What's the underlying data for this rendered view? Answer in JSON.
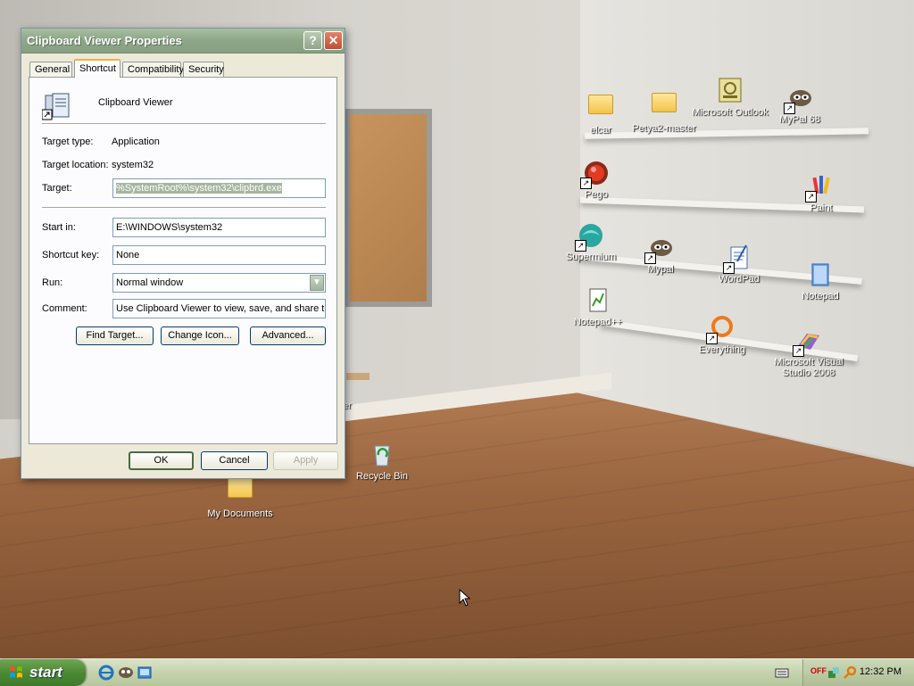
{
  "window": {
    "title": "Clipboard Viewer Properties",
    "help_glyph": "?",
    "close_glyph": "✕",
    "tabs": [
      "General",
      "Shortcut",
      "Compatibility",
      "Security"
    ],
    "active_tab": "Shortcut",
    "app_name": "Clipboard Viewer",
    "fields": {
      "target_type_label": "Target type:",
      "target_type_value": "Application",
      "target_location_label": "Target location:",
      "target_location_value": "system32",
      "target_label": "Target:",
      "target_value": "%SystemRoot%\\system32\\clipbrd.exe",
      "start_in_label": "Start in:",
      "start_in_value": "E:\\WINDOWS\\system32",
      "shortcut_key_label": "Shortcut key:",
      "shortcut_key_value": "None",
      "run_label": "Run:",
      "run_value": "Normal window",
      "comment_label": "Comment:",
      "comment_value": "Use Clipboard Viewer to view, save, and share te:"
    },
    "buttons": {
      "find_target": "Find Target...",
      "change_icon": "Change Icon...",
      "advanced": "Advanced...",
      "ok": "OK",
      "cancel": "Cancel",
      "apply": "Apply"
    }
  },
  "desktop": {
    "icons": [
      {
        "label": "elcar",
        "icon": "folder-icon"
      },
      {
        "label": "Petya2-master",
        "icon": "folder-icon"
      },
      {
        "label": "Microsoft Outlook",
        "icon": "outlook-icon"
      },
      {
        "label": "MyPal 68",
        "icon": "mypal-icon"
      },
      {
        "label": "Pego",
        "icon": "pego-icon"
      },
      {
        "label": "Paint",
        "icon": "paint-icon"
      },
      {
        "label": "Supermium",
        "icon": "supermium-icon"
      },
      {
        "label": "Mypal",
        "icon": "mypal-icon"
      },
      {
        "label": "WordPad",
        "icon": "wordpad-icon"
      },
      {
        "label": "Notepad",
        "icon": "notepad-icon"
      },
      {
        "label": "Notepad++",
        "icon": "notepadpp-icon"
      },
      {
        "label": "Everything",
        "icon": "everything-icon"
      },
      {
        "label": "Microsoft Visual Studio 2008",
        "icon": "visual-studio-icon"
      },
      {
        "label": "Recycle Bin",
        "icon": "recycle-bin-icon"
      },
      {
        "label": "My Documents",
        "icon": "my-documents-icon"
      }
    ],
    "partial_label": "er"
  },
  "taskbar": {
    "start_label": "start",
    "clock": "12:32 PM",
    "tray_off": "OFF"
  },
  "colors": {
    "titlebar": "#8fa88a",
    "start_button": "#4c8a35",
    "dialog_bg": "#ece9d8"
  }
}
